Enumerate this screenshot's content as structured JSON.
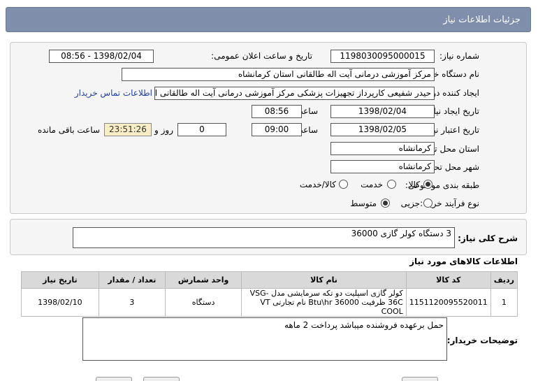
{
  "header": {
    "title": "جزئیات اطلاعات نیاز"
  },
  "form": {
    "need_number_label": "شماره نیاز:",
    "need_number": "1198030095000015",
    "announce_label": "تاریخ و ساعت اعلان عمومی:",
    "announce_value": "1398/02/04 - 08:56",
    "buyer_org_label": "نام دستگاه خریدار:",
    "buyer_org": "مرکز آموزشی درمانی آیت اله طالقانی استان کرمانشاه",
    "creator_label": "ایجاد کننده درخواست:",
    "creator": "حیدر شفیعی کارپرداز تجهیزات پزشکی مرکز آموزشی درمانی آیت اله طالقانی استان کرمانشاه",
    "contact_link": "اطلاعات تماس خریدار",
    "created_date_label": "تاریخ ایجاد نیاز:",
    "created_date": "1398/02/04",
    "time_label": "ساعت",
    "created_time": "08:56",
    "valid_date_label": "تاریخ اعتبار نیاز:",
    "valid_date": "1398/02/05",
    "valid_time": "09:00",
    "days_value": "0",
    "days_label": "روز و",
    "remaining_value": "23:51:26",
    "remaining_label": "ساعت باقی مانده",
    "province_label": "استان محل تحویل:",
    "province": "کرمانشاه",
    "city_label": "شهر محل تحویل:",
    "city": "کرمانشاه",
    "category_label": "طبقه بندی موضوعی:",
    "category_options": [
      "کالا",
      "خدمت",
      "کالا/خدمت"
    ],
    "category_selected": "کالا",
    "process_label": "نوع فرآیند خرید :",
    "process_options": [
      "جزیی",
      "متوسط"
    ],
    "process_selected": "متوسط"
  },
  "description": {
    "label": "شرح کلی نیاز:",
    "text": "3 دستگاه کولر گازی 36000"
  },
  "items_section": {
    "title": "اطلاعات کالاهای مورد نیاز",
    "columns": [
      "ردیف",
      "کد کالا",
      "نام کالا",
      "واحد شمارش",
      "تعداد / مقدار",
      "تاریخ نیاز"
    ],
    "rows": [
      {
        "index": "1",
        "code": "1151120095520011",
        "name": "کولر گازی اسپلیت دو تکه سرمایشی مدل VSG-36C ظرفیت 36000 Btu\\hr نام تجارتی VT COOL",
        "unit": "دستگاه",
        "qty": "3",
        "date": "1398/02/10"
      }
    ]
  },
  "buyer_notes": {
    "label": "توضیحات خریدار:",
    "text": "حمل برعهده فروشنده میباشد پرداخت 2 ماهه"
  }
}
